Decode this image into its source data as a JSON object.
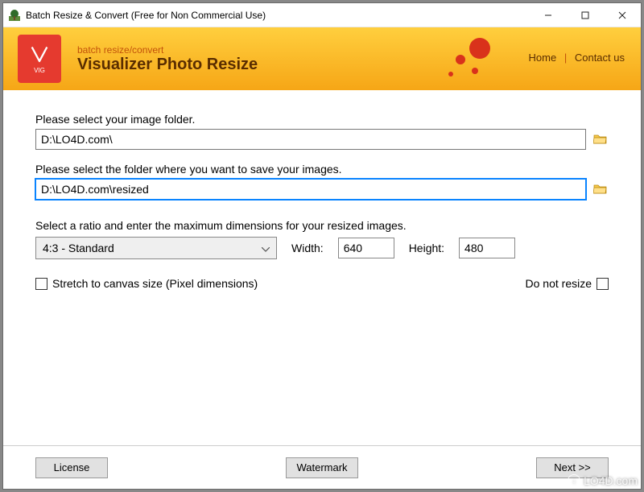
{
  "window": {
    "title": "Batch Resize & Convert (Free for Non Commercial Use)"
  },
  "banner": {
    "subtitle": "batch resize/convert",
    "title": "Visualizer Photo Resize",
    "logo_text": "VIG",
    "links": {
      "home": "Home",
      "contact": "Contact us"
    }
  },
  "form": {
    "source_label": "Please select your image folder.",
    "source_path": "D:\\LO4D.com\\",
    "dest_label": "Please select the folder where you want to save your images.",
    "dest_path": "D:\\LO4D.com\\resized",
    "ratio_label": "Select a ratio and enter the maximum dimensions for your resized images.",
    "ratio_selected": "4:3   -   Standard",
    "width_label": "Width:",
    "width_value": "640",
    "height_label": "Height:",
    "height_value": "480",
    "stretch_label": "Stretch to canvas size (Pixel dimensions)",
    "noresize_label": "Do not resize"
  },
  "footer": {
    "license": "License",
    "watermark": "Watermark",
    "next": "Next >>"
  },
  "site_watermark": "LO4D.com"
}
